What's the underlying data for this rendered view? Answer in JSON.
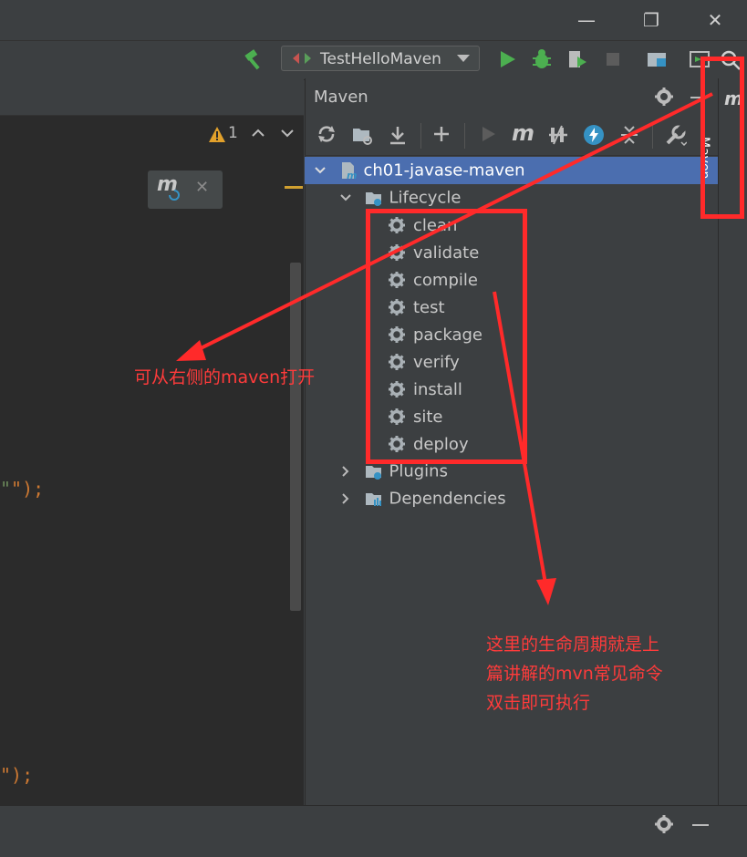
{
  "window": {
    "minimize_glyph": "—",
    "restore_glyph": "❐",
    "close_glyph": "✕"
  },
  "toolbar": {
    "run_config": "TestHelloMaven"
  },
  "editor": {
    "warning_count": "1",
    "code_line_1": "\");",
    "code_line_2": "\");",
    "mvn_badge": "m"
  },
  "maven": {
    "title": "Maven",
    "tab_label": "Maven",
    "project": "ch01-javase-maven",
    "lifecycle": "Lifecycle",
    "phases": [
      "clean",
      "validate",
      "compile",
      "test",
      "package",
      "verify",
      "install",
      "site",
      "deploy"
    ],
    "plugins": "Plugins",
    "dependencies": "Dependencies"
  },
  "annotations": {
    "left_note": "可从右侧的maven打开",
    "right_note_1": "这里的生命周期就是上",
    "right_note_2": "篇讲解的mvn常见命令",
    "right_note_3": "双击即可执行"
  },
  "colors": {
    "accent_red": "#ff2a2a",
    "selection": "#4b6eaf",
    "run_green": "#4caf50"
  }
}
